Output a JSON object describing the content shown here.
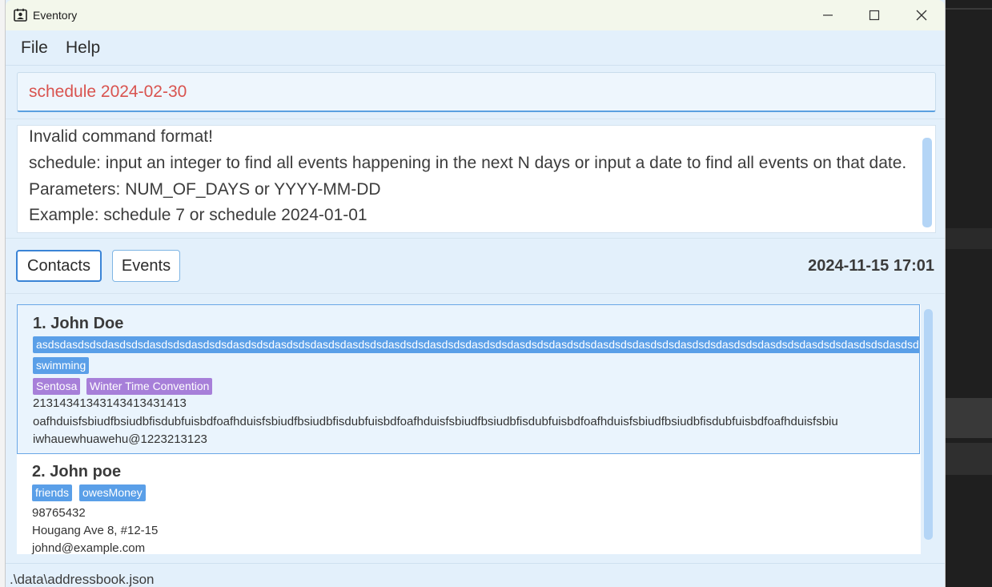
{
  "window": {
    "title": "Eventory"
  },
  "menu": {
    "file": "File",
    "help": "Help"
  },
  "command": {
    "value": "schedule 2024-02-30"
  },
  "result": {
    "lines": [
      "Invalid command format!",
      "schedule: input an integer to find all events happening in the next N days or input a date to find all events on that date.",
      "Parameters: NUM_OF_DAYS or YYYY-MM-DD",
      "Example: schedule 7 or schedule 2024-01-01"
    ]
  },
  "tabs": {
    "contacts": "Contacts",
    "events": "Events"
  },
  "datetime": "2024-11-15 17:01",
  "contacts": [
    {
      "name": "1. John Doe",
      "tags": [
        "asdsdasdsdsdasdsdsdasdsdsdasdsdsdasdsdsdasdsdsdasdsdasdsdsdasdsdsdasdsdsdasdsdsdasdsdsdasdsdsdasdsdsdasdsdsdasdsdsdasdsdsdasdsdsdasdsdsdasdsdsdasdsdsdasdsdsdasdsdsda",
        "swimming"
      ],
      "event_tags": [
        "Sentosa",
        "Winter Time Convention"
      ],
      "phone": "21314341343143413431413",
      "address": "oafhduisfsbiudfbsiudbfisdubfuisbdfoafhduisfsbiudfbsiudbfisdubfuisbdfoafhduisfsbiudfbsiudbfisdubfuisbdfoafhduisfsbiudfbsiudbfisdubfuisbdfoafhduisfsbiu",
      "email": "iwhauewhuawehu@1223213123"
    },
    {
      "name": "2. John poe",
      "tags": [
        "friends",
        "owesMoney"
      ],
      "phone": "98765432",
      "address": "Hougang Ave 8, #12-15",
      "email": "johnd@example.com"
    }
  ],
  "status": {
    "path": ".\\data\\addressbook.json"
  },
  "colors": {
    "accent": "#3a84d6",
    "tag_blue": "#5a9fe8",
    "tag_purple": "#a77fd9",
    "error_text": "#d9534f",
    "background": "#e3f0fb"
  }
}
